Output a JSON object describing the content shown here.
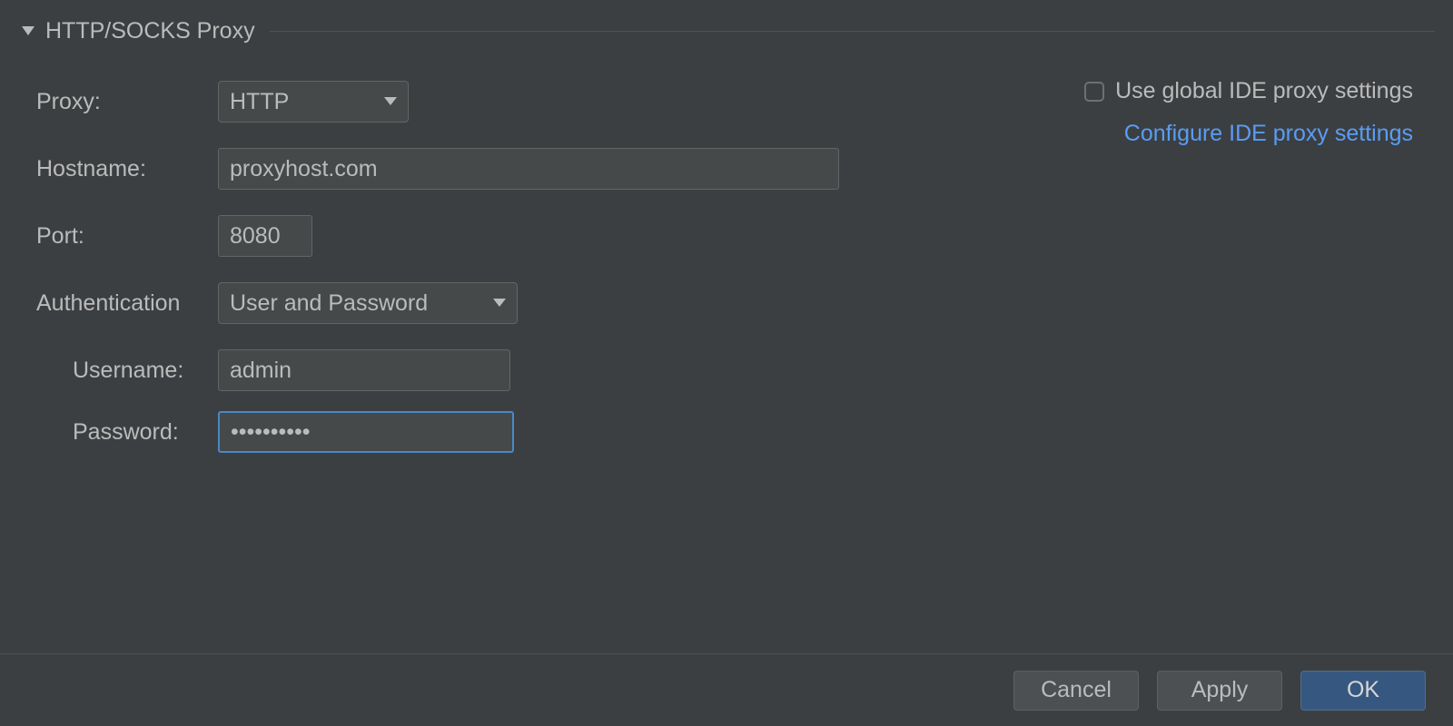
{
  "section": {
    "title": "HTTP/SOCKS Proxy"
  },
  "labels": {
    "proxy": "Proxy:",
    "hostname": "Hostname:",
    "port": "Port:",
    "auth": "Authentication",
    "username": "Username:",
    "password": "Password:"
  },
  "fields": {
    "proxy_selected": "HTTP",
    "hostname": "proxyhost.com",
    "port": "8080",
    "auth_selected": "User and Password",
    "username": "admin",
    "password": "••••••••••"
  },
  "right": {
    "use_global": "Use global IDE proxy settings",
    "configure_link": "Configure IDE proxy settings"
  },
  "buttons": {
    "cancel": "Cancel",
    "apply": "Apply",
    "ok": "OK"
  }
}
